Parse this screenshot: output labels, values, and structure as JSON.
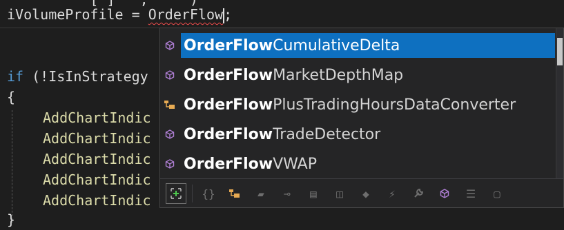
{
  "editor": {
    "top_partial": "          [ ]   ,     )",
    "line1": {
      "var": "iVolumeProfile",
      "assign": " = ",
      "typed": "OrderFlow",
      "after": ";"
    },
    "if_line": {
      "keyword": "if",
      "text": " (!IsInStrategy"
    },
    "brace_open": "{",
    "brace_close": "}",
    "add_lines": [
      "AddChartIndic",
      "AddChartIndic",
      "AddChartIndic",
      "AddChartIndic",
      "AddChartIndic"
    ]
  },
  "completion": {
    "match": "OrderFlow",
    "items": [
      {
        "suffix": "CumulativeDelta",
        "icon": "cube-icon",
        "selected": true
      },
      {
        "suffix": "MarketDepthMap",
        "icon": "cube-icon",
        "selected": false
      },
      {
        "suffix": "PlusTradingHoursDataConverter",
        "icon": "namespace-icon",
        "selected": false
      },
      {
        "suffix": "TradeDetector",
        "icon": "cube-icon",
        "selected": false
      },
      {
        "suffix": "VWAP",
        "icon": "cube-icon",
        "selected": false
      }
    ],
    "filters": [
      {
        "name": "expand-icon",
        "glyph": "+"
      },
      {
        "name": "braces-icon",
        "glyph": "{}"
      },
      {
        "name": "namespace-filter-icon",
        "glyph": "⬙"
      },
      {
        "name": "class-icon",
        "glyph": "▰"
      },
      {
        "name": "interface-icon",
        "glyph": "⊸"
      },
      {
        "name": "struct-icon",
        "glyph": "▤"
      },
      {
        "name": "module-icon",
        "glyph": "◫"
      },
      {
        "name": "enum-icon",
        "glyph": "◆"
      },
      {
        "name": "event-icon",
        "glyph": "⚡"
      },
      {
        "name": "wrench-icon",
        "glyph": "🔧"
      },
      {
        "name": "cube-filter-icon",
        "glyph": "⬡"
      },
      {
        "name": "snippet-icon",
        "glyph": "☰"
      },
      {
        "name": "blank-icon",
        "glyph": "▢"
      }
    ]
  },
  "colors": {
    "background": "#1e1e1e",
    "keyword": "#569cd6",
    "method": "#dcdcaa",
    "selection": "#0e70c0",
    "cube": "#b180d7",
    "namespace": "#e8ab53",
    "expand": "#4ec94e"
  }
}
